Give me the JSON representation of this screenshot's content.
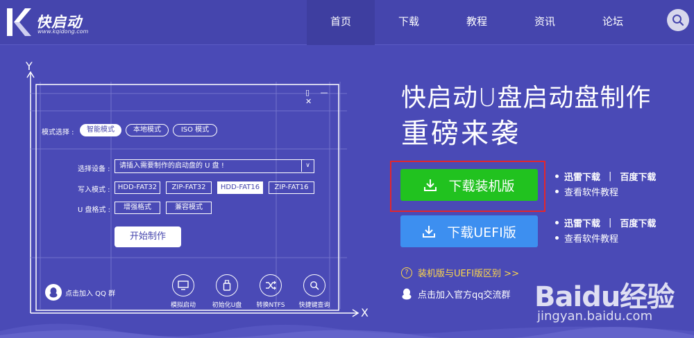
{
  "brand": {
    "name": "快启动",
    "url": "www.kqidong.com"
  },
  "nav": {
    "items": [
      {
        "label": "首页",
        "active": true
      },
      {
        "label": "下载",
        "active": false
      },
      {
        "label": "教程",
        "active": false
      },
      {
        "label": "资讯",
        "active": false
      },
      {
        "label": "论坛",
        "active": false
      }
    ],
    "search_icon": "search-icon"
  },
  "illustration": {
    "axis_y": "Y",
    "axis_x": "X",
    "window_controls": "▯ — ✕",
    "mode_label": "模式选择 :",
    "modes": [
      {
        "label": "智能模式",
        "selected": true
      },
      {
        "label": "本地模式",
        "selected": false
      },
      {
        "label": "ISO 模式",
        "selected": false
      }
    ],
    "device_label": "选择设备 :",
    "device_placeholder": "请插入需要制作的启动盘的 U 盘 !",
    "write_label": "写入模式 :",
    "write_modes": [
      {
        "label": "HDD-FAT32",
        "selected": false
      },
      {
        "label": "ZIP-FAT32",
        "selected": false
      },
      {
        "label": "HDD-FAT16",
        "selected": true
      },
      {
        "label": "ZIP-FAT16",
        "selected": false
      }
    ],
    "format_label": "U 盘格式 :",
    "formats": [
      {
        "label": "增强格式"
      },
      {
        "label": "兼容模式"
      }
    ],
    "start_button": "开始制作",
    "qq_group": "点击加入 QQ 群",
    "tools": [
      {
        "label": "模拟启动",
        "icon": "monitor-icon"
      },
      {
        "label": "初始化U盘",
        "icon": "usb-drive-icon"
      },
      {
        "label": "转换NTFS",
        "icon": "shuffle-icon"
      },
      {
        "label": "快捷键查询",
        "icon": "magnifier-icon"
      }
    ]
  },
  "promo": {
    "headline_line1": "快启动U盘启动盘制作",
    "headline_line2": "重磅来袭",
    "download_install": "下载装机版",
    "download_uefi": "下载UEFI版",
    "mirror_thunder": "迅雷下载",
    "separator": "|",
    "mirror_baidu": "百度下载",
    "tutorial": "查看软件教程",
    "difference": "装机版与UEFI版区别 >>",
    "join_qq": "点击加入官方qq交流群"
  },
  "watermark": {
    "text": "Baidu经验",
    "url": "jingyan.baidu.com"
  },
  "colors": {
    "background": "#4a4ab6",
    "header": "#4545ad",
    "nav_active": "#3e3ea0",
    "green_button": "#21c21f",
    "blue_button": "#3d8ff0",
    "highlight": "#e3262c",
    "link_yellow": "#ffd84a"
  }
}
